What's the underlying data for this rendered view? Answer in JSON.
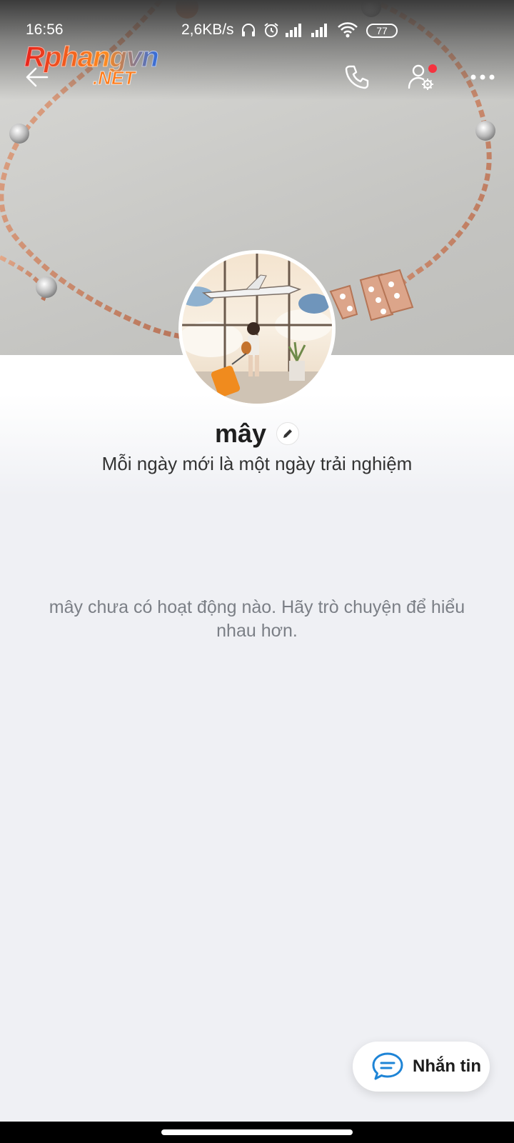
{
  "status_bar": {
    "time": "16:56",
    "network_speed": "2,6KB/s",
    "battery": "77",
    "icons": [
      "headphones-icon",
      "alarm-icon",
      "signal-icon",
      "signal-icon",
      "wifi-icon",
      "battery-icon"
    ]
  },
  "watermark": {
    "main": "Rphangvn",
    "sub": ".NET"
  },
  "header": {
    "actions": [
      "back-arrow-icon",
      "phone-icon",
      "user-settings-icon",
      "more-icon"
    ],
    "settings_has_notification": true
  },
  "profile": {
    "name": "mây",
    "bio": "Mỗi ngày mới là một ngày trải nghiệm",
    "empty_activity": "mây chưa có hoạt động nào. Hãy trò chuyện để hiểu nhau hơn."
  },
  "actions": {
    "message_label": "Nhắn tin"
  },
  "colors": {
    "accent": "#1e84d6",
    "notification": "#f5333f",
    "background": "#eff0f4"
  }
}
